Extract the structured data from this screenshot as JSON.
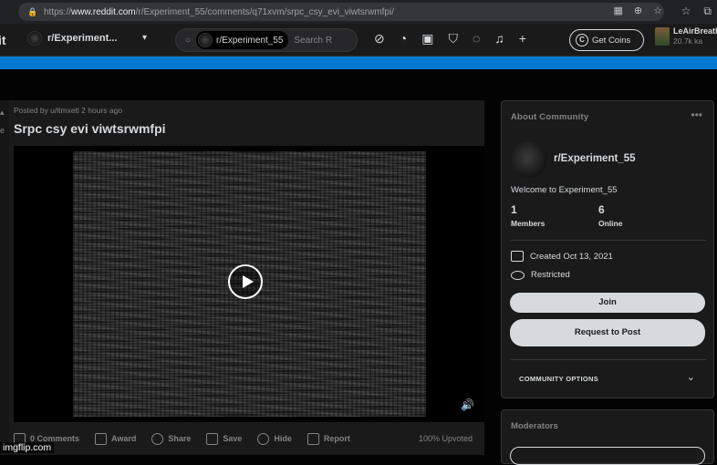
{
  "browser": {
    "url_prefix": "https://",
    "url_host": "www.reddit.com",
    "url_path": "/r/Experiment_55/comments/q71xvm/srpc_csy_evi_viwtsrwmfpi/"
  },
  "header": {
    "logo_text": "it",
    "community": "r/Experiment...",
    "search_chip": "r/Experiment_55",
    "search_placeholder": "Search R",
    "get_coins": "Get Coins",
    "coin_glyph": "C",
    "username": "LeAirBreath",
    "karma": "20.7k ka",
    "accent": "#0079d3"
  },
  "post": {
    "posted_by": "Posted by u/ltmxetl 2 hours ago",
    "title": "Srpc csy evi viwtsrwmfpi",
    "actions": [
      {
        "label": "0 Comments",
        "icon": "comment-icon"
      },
      {
        "label": "Award",
        "icon": "award-icon"
      },
      {
        "label": "Share",
        "icon": "share-icon"
      },
      {
        "label": "Save",
        "icon": "bookmark-icon"
      },
      {
        "label": "Hide",
        "icon": "hide-icon"
      },
      {
        "label": "Report",
        "icon": "flag-icon"
      }
    ],
    "upvoted": "100% Upvoted"
  },
  "about": {
    "title": "About Community",
    "name": "r/Experiment_55",
    "welcome": "Welcome to Experiment_55",
    "members_count": "1",
    "members_label": "Members",
    "online_count": "6",
    "online_label": "Online",
    "created": "Created Oct 13, 2021",
    "restricted": "Restricted",
    "join": "Join",
    "request": "Request to Post",
    "options": "COMMUNITY OPTIONS"
  },
  "moderators": {
    "title": "Moderators"
  },
  "watermark": "imgflip.com"
}
